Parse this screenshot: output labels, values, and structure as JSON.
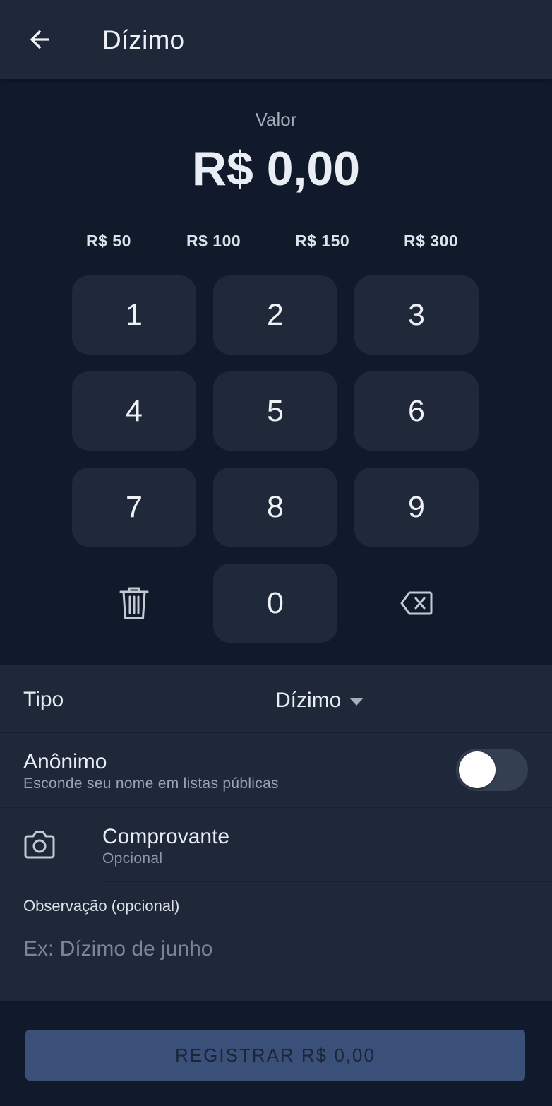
{
  "header": {
    "title": "Dízimo",
    "back_icon": "arrow-left-icon"
  },
  "amount": {
    "label": "Valor",
    "value": "R$ 0,00"
  },
  "quick_amounts": [
    "R$ 50",
    "R$ 100",
    "R$ 150",
    "R$ 300"
  ],
  "keypad": {
    "keys": [
      "1",
      "2",
      "3",
      "4",
      "5",
      "6",
      "7",
      "8",
      "9",
      "0"
    ],
    "clear_icon": "trash-icon",
    "backspace_icon": "backspace-icon"
  },
  "form": {
    "tipo": {
      "label": "Tipo",
      "value": "Dízimo"
    },
    "anonimo": {
      "title": "Anônimo",
      "subtitle": "Esconde seu nome em listas públicas",
      "enabled": false
    },
    "comprovante": {
      "title": "Comprovante",
      "subtitle": "Opcional",
      "icon": "camera-icon"
    },
    "observacao": {
      "label": "Observação (opcional)",
      "value": "",
      "placeholder": "Ex: Dízimo de junho"
    }
  },
  "submit": {
    "label": "REGISTRAR R$ 0,00"
  },
  "colors": {
    "background": "#111a2b",
    "surface": "#1f2838",
    "key": "#1f2939",
    "submit": "#3a5079"
  }
}
